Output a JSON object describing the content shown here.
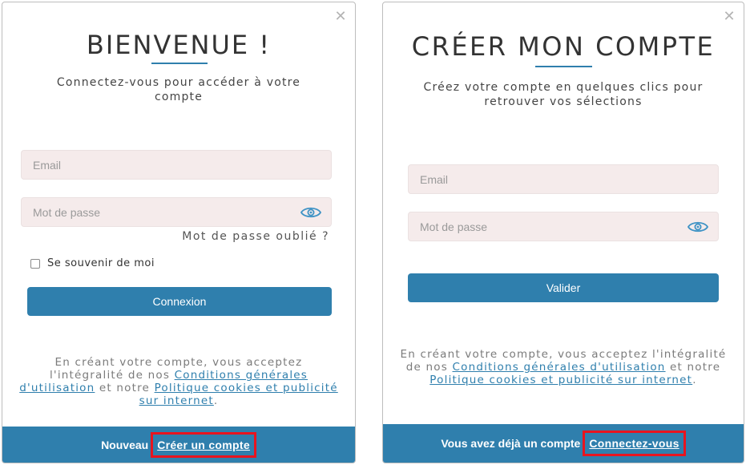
{
  "login": {
    "title": "BIENVENUE !",
    "subtitle": "Connectez-vous pour accéder à votre compte",
    "email_placeholder": "Email",
    "password_placeholder": "Mot de passe",
    "forgot_password": "Mot de passe oublié ?",
    "remember_me": "Se souvenir de moi",
    "submit": "Connexion",
    "legal_prefix": "En créant votre compte, vous acceptez l'intégralité de nos",
    "legal_terms": "Conditions générales d'utilisation",
    "legal_middle": "et notre",
    "legal_privacy": "Politique cookies et publicité sur internet",
    "legal_suffix": ".",
    "footer_text": "Nouveau",
    "footer_link": "Créer un compte"
  },
  "signup": {
    "title": "CRÉER MON COMPTE",
    "subtitle": "Créez votre compte en quelques clics pour retrouver vos sélections",
    "email_placeholder": "Email",
    "password_placeholder": "Mot de passe",
    "submit": "Valider",
    "legal_prefix": "En créant votre compte, vous acceptez l'intégralité de nos",
    "legal_terms": "Conditions générales d'utilisation",
    "legal_middle": "et notre",
    "legal_privacy": "Politique cookies et publicité sur internet",
    "legal_suffix": ".",
    "footer_text": "Vous avez déjà un compte",
    "footer_link": "Connectez-vous"
  },
  "icons": {
    "close": "close-icon",
    "eye": "eye-icon"
  },
  "colors": {
    "accent": "#2f7fad",
    "highlight": "#e8141f",
    "field_bg": "#f5ebeb"
  }
}
